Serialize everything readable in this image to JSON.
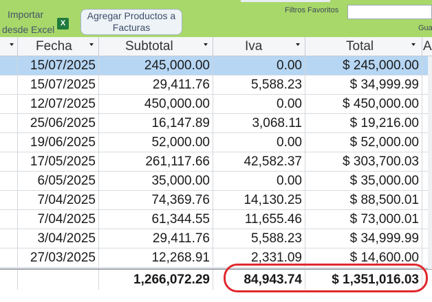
{
  "toolbar": {
    "import_line1": "Importar",
    "import_line2": "desde Excel",
    "excel_icon_glyph": "X",
    "add_products_label": "Agregar Productos a Facturas",
    "filtros_label": "Filtros Favoritos",
    "filtros_value": "",
    "gua_label": "Gua"
  },
  "columns": [
    {
      "key": "fecha",
      "label": "Fecha"
    },
    {
      "key": "subtotal",
      "label": "Subtotal"
    },
    {
      "key": "iva",
      "label": "Iva"
    },
    {
      "key": "total",
      "label": "Total"
    },
    {
      "key": "extra",
      "label": "A"
    }
  ],
  "rows": [
    {
      "fecha": "15/07/2025",
      "subtotal": "245,000.00",
      "iva": "0.00",
      "total": "$ 245,000.00",
      "selected": true
    },
    {
      "fecha": "15/07/2025",
      "subtotal": "29,411.76",
      "iva": "5,588.23",
      "total": "$ 34,999.99"
    },
    {
      "fecha": "12/07/2025",
      "subtotal": "450,000.00",
      "iva": "0.00",
      "total": "$ 450,000.00"
    },
    {
      "fecha": "25/06/2025",
      "subtotal": "16,147.89",
      "iva": "3,068.11",
      "total": "$ 19,216.00"
    },
    {
      "fecha": "19/06/2025",
      "subtotal": "52,000.00",
      "iva": "0.00",
      "total": "$ 52,000.00"
    },
    {
      "fecha": "17/05/2025",
      "subtotal": "261,117.66",
      "iva": "42,582.37",
      "total": "$ 303,700.03"
    },
    {
      "fecha": "6/05/2025",
      "subtotal": "35,000.00",
      "iva": "0.00",
      "total": "$ 35,000.00"
    },
    {
      "fecha": "7/04/2025",
      "subtotal": "74,369.76",
      "iva": "14,130.25",
      "total": "$ 88,500.01"
    },
    {
      "fecha": "7/04/2025",
      "subtotal": "61,344.55",
      "iva": "11,655.46",
      "total": "$ 73,000.01"
    },
    {
      "fecha": "3/04/2025",
      "subtotal": "29,411.76",
      "iva": "5,588.23",
      "total": "$ 34,999.99"
    },
    {
      "fecha": "27/03/2025",
      "subtotal": "12,268.91",
      "iva": "2,331.09",
      "total": "$ 14,600.00"
    }
  ],
  "totals": {
    "subtotal": "1,266,072.29",
    "iva": "84,943.74",
    "total": "$ 1,351,016.03"
  },
  "colors": {
    "toolbar": "#a8d86a",
    "selected_row": "#b6d6f4",
    "highlight": "#e0282e"
  }
}
